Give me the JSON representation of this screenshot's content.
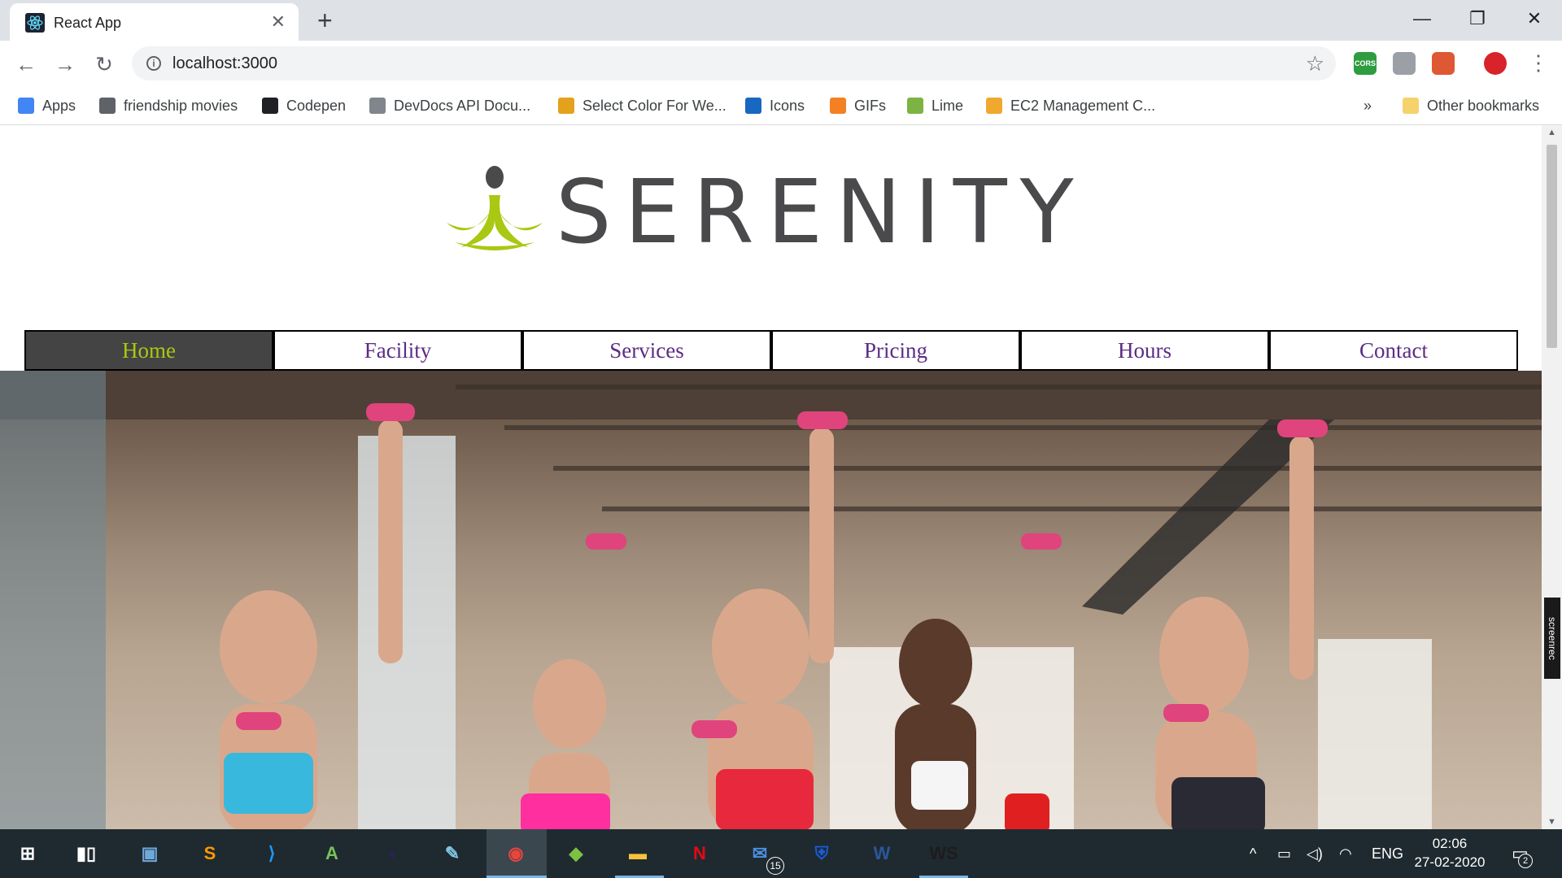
{
  "browser": {
    "tab_title": "React App",
    "tab_close": "✕",
    "new_tab": "+",
    "url": "localhost:3000",
    "window_minimize": "—",
    "window_restore": "❐",
    "window_close": "✕",
    "extensions": [
      {
        "name": "cors-extension-icon",
        "label": "CORS",
        "color": "#2e9c3f"
      },
      {
        "name": "cube-extension-icon",
        "label": "",
        "color": "#9aa0a6"
      },
      {
        "name": "duckduckgo-extension-icon",
        "label": "",
        "color": "#de5833"
      },
      {
        "name": "profile-avatar",
        "label": "",
        "color": "#d8232a"
      }
    ],
    "bookmarks": [
      {
        "label": "Apps",
        "icon": "apps-grid-icon",
        "color": "#4285f4"
      },
      {
        "label": "friendship movies",
        "icon": "globe-icon",
        "color": "#5f6368"
      },
      {
        "label": "Codepen",
        "icon": "codepen-icon",
        "color": "#202124"
      },
      {
        "label": "DevDocs API Docu...",
        "icon": "devdocs-icon",
        "color": "#80868b"
      },
      {
        "label": "Select Color For We...",
        "icon": "color-cup-icon",
        "color": "#e4a11b"
      },
      {
        "label": "Icons",
        "icon": "vuetify-icon",
        "color": "#1867c0"
      },
      {
        "label": "GIFs",
        "icon": "gifs-stack-icon",
        "color": "#f48024"
      },
      {
        "label": "Lime",
        "icon": "lime-icon",
        "color": "#7cb342"
      },
      {
        "label": "EC2 Management C...",
        "icon": "aws-box-icon",
        "color": "#f0a92e"
      }
    ],
    "bookmarks_overflow": "»",
    "other_bookmarks": "Other bookmarks"
  },
  "site": {
    "brand": "SERENITY",
    "brand_colors": {
      "text": "#4a4a4c",
      "accent": "#a8c812"
    },
    "nav": [
      {
        "label": "Home",
        "active": true
      },
      {
        "label": "Facility",
        "active": false
      },
      {
        "label": "Services",
        "active": false
      },
      {
        "label": "Pricing",
        "active": false
      },
      {
        "label": "Hours",
        "active": false
      },
      {
        "label": "Contact",
        "active": false
      }
    ],
    "nav_colors": {
      "link": "#5b2c86",
      "active_bg": "#444444",
      "active_text": "#a8c812"
    }
  },
  "overlay": {
    "screenrec": "screenrec"
  },
  "taskbar": {
    "apps": [
      {
        "name": "start-button",
        "label": "⊞",
        "color": "#ffffff"
      },
      {
        "name": "task-view-button",
        "label": "▮▯",
        "color": "#ffffff"
      },
      {
        "name": "virtualbox-app",
        "label": "▣",
        "color": "#6fa8dc"
      },
      {
        "name": "sublime-text-app",
        "label": "S",
        "color": "#ff9800"
      },
      {
        "name": "vscode-app",
        "label": "⟩",
        "color": "#2196f3"
      },
      {
        "name": "android-studio-app",
        "label": "A",
        "color": "#78c257"
      },
      {
        "name": "eclipse-app",
        "label": "◐",
        "color": "#2c2255"
      },
      {
        "name": "notepad-app",
        "label": "✎",
        "color": "#7fc8e0"
      },
      {
        "name": "chrome-app",
        "label": "◉",
        "color": "#e8453c"
      },
      {
        "name": "bluestacks-app",
        "label": "◆",
        "color": "#7cc142"
      },
      {
        "name": "file-explorer-app",
        "label": "▬",
        "color": "#f8c33c"
      },
      {
        "name": "netflix-app",
        "label": "N",
        "color": "#e50914"
      },
      {
        "name": "mail-app",
        "label": "✉",
        "color": "#4a90e2"
      },
      {
        "name": "bitwarden-app",
        "label": "⛨",
        "color": "#175ddc"
      },
      {
        "name": "word-app",
        "label": "W",
        "color": "#2b579a"
      },
      {
        "name": "webstorm-app",
        "label": "WS",
        "color": "#1c1c1c"
      }
    ],
    "mail_badge": "15",
    "tray_chevron": "^",
    "language": "ENG",
    "time": "02:06",
    "date": "27-02-2020",
    "notification_count": "2"
  }
}
